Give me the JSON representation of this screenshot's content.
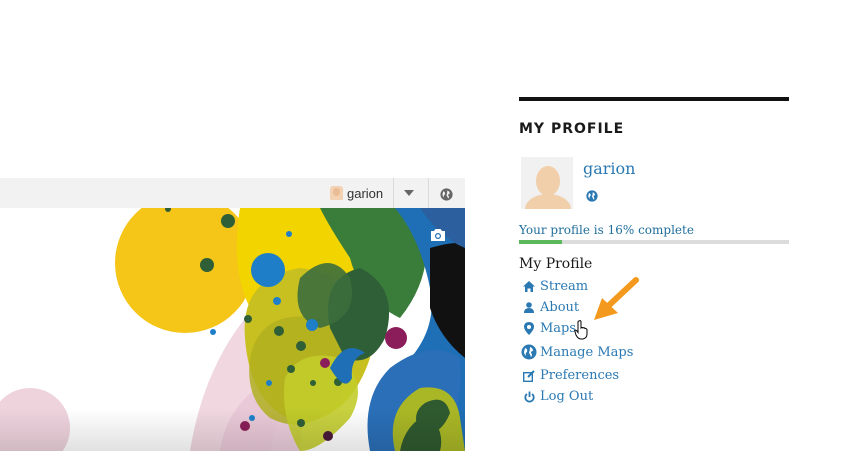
{
  "profile_bar": {
    "username": "garion",
    "dropdown_icon": "caret-down-icon",
    "globe_icon": "globe-icon",
    "camera_icon": "camera-icon"
  },
  "sidebar": {
    "title": "MY PROFILE",
    "username": "garion",
    "progress": {
      "text": "Your profile is 16% complete",
      "percent": 16
    },
    "section_label": "My Profile",
    "menu": [
      {
        "label": "Stream",
        "icon": "home-icon"
      },
      {
        "label": "About",
        "icon": "user-icon"
      },
      {
        "label": "Maps",
        "icon": "map-marker-icon"
      },
      {
        "label": "Manage Maps",
        "icon": "globe-icon"
      },
      {
        "label": "Preferences",
        "icon": "edit-icon"
      },
      {
        "label": "Log Out",
        "icon": "power-icon"
      }
    ]
  },
  "colors": {
    "link": "#2a79b3",
    "progress": "#5cb85c",
    "arrow": "#f39a1e"
  }
}
